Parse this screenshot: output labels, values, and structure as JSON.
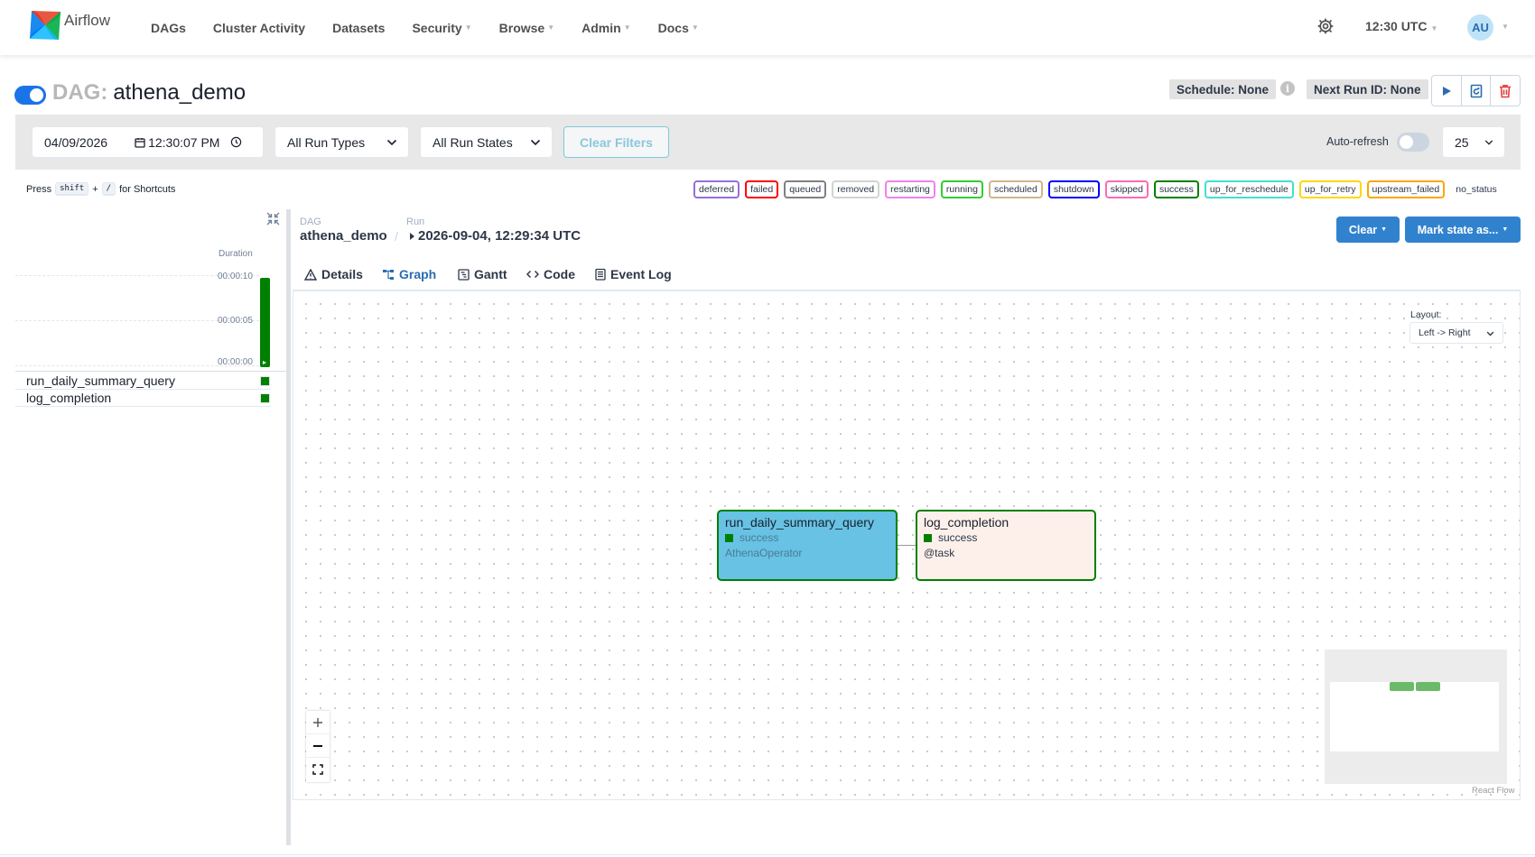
{
  "nav": {
    "logo_text": "Airflow",
    "items": [
      {
        "label": "DAGs",
        "dropdown": false
      },
      {
        "label": "Cluster Activity",
        "dropdown": false
      },
      {
        "label": "Datasets",
        "dropdown": false
      },
      {
        "label": "Security",
        "dropdown": true
      },
      {
        "label": "Browse",
        "dropdown": true
      },
      {
        "label": "Admin",
        "dropdown": true
      },
      {
        "label": "Docs",
        "dropdown": true
      }
    ],
    "time": "12:30 UTC",
    "user_initials": "AU"
  },
  "dag": {
    "prefix": "DAG:",
    "name": "athena_demo",
    "schedule": "Schedule: None",
    "next_run": "Next Run ID: None"
  },
  "filters": {
    "date": "04/09/2026",
    "time": "12:30:07 PM",
    "run_types": "All Run Types",
    "run_states": "All Run States",
    "clear_filters": "Clear Filters",
    "auto_refresh": "Auto-refresh",
    "page_size": "25"
  },
  "shortcuts": {
    "press": "Press",
    "key1": "shift",
    "plus": "+",
    "key2": "/",
    "suffix": "for Shortcuts"
  },
  "legend": [
    {
      "label": "deferred",
      "color": "#9370db"
    },
    {
      "label": "failed",
      "color": "#ff0000"
    },
    {
      "label": "queued",
      "color": "#808080"
    },
    {
      "label": "removed",
      "color": "#d3d3d3"
    },
    {
      "label": "restarting",
      "color": "#ee82ee"
    },
    {
      "label": "running",
      "color": "#32cd32"
    },
    {
      "label": "scheduled",
      "color": "#d2b48c"
    },
    {
      "label": "shutdown",
      "color": "#0000ff"
    },
    {
      "label": "skipped",
      "color": "#ff69b4"
    },
    {
      "label": "success",
      "color": "#008000"
    },
    {
      "label": "up_for_reschedule",
      "color": "#40e0d0"
    },
    {
      "label": "up_for_retry",
      "color": "#ffd700"
    },
    {
      "label": "upstream_failed",
      "color": "#ffa500"
    },
    {
      "label": "no_status",
      "color": "transparent"
    }
  ],
  "grid": {
    "duration_label": "Duration",
    "ticks": [
      "00:00:10",
      "00:00:05",
      "00:00:00"
    ],
    "tasks": [
      "run_daily_summary_query",
      "log_completion"
    ]
  },
  "details": {
    "dag_label": "DAG",
    "run_label": "Run",
    "dag_name": "athena_demo",
    "run_id": "2026-09-04, 12:29:34 UTC",
    "clear_btn": "Clear",
    "mark_btn": "Mark state as...",
    "tabs": [
      "Details",
      "Graph",
      "Gantt",
      "Code",
      "Event Log"
    ],
    "active_tab": "Graph"
  },
  "graph": {
    "layout_label": "Layout:",
    "layout_value": "Left -> Right",
    "nodes": [
      {
        "name": "run_daily_summary_query",
        "state": "success",
        "operator": "AthenaOperator",
        "color": "#67c2e4",
        "op_color": "#4a7c93"
      },
      {
        "name": "log_completion",
        "state": "success",
        "operator": "@task",
        "color": "#fdf0eb",
        "op_color": "#2d3748"
      }
    ],
    "attribution": "React Flow"
  }
}
